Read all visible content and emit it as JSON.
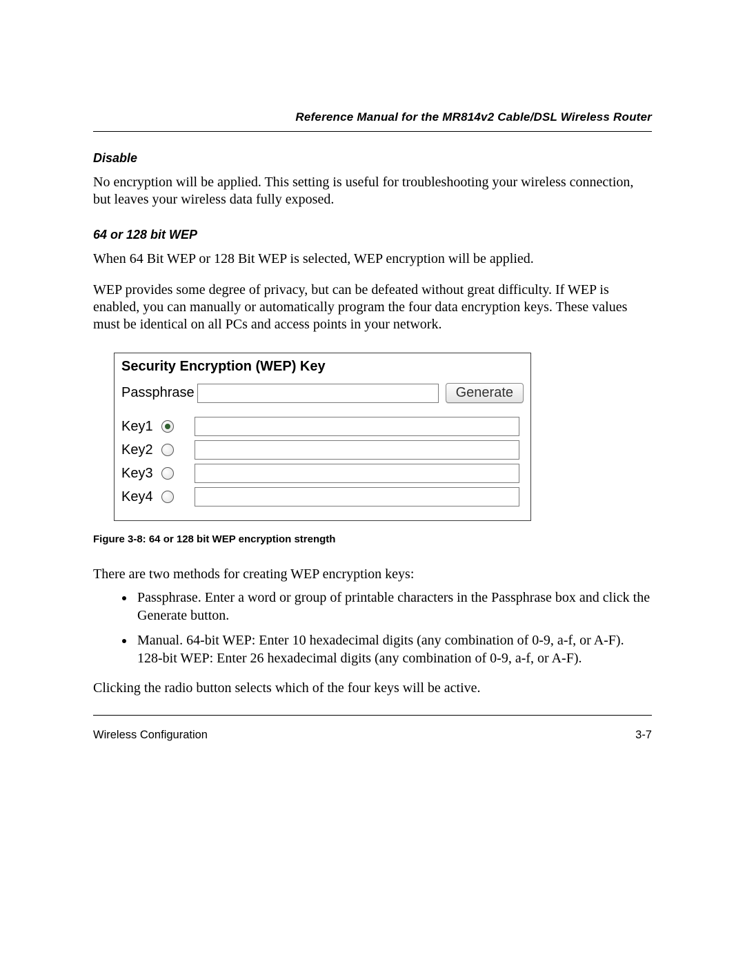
{
  "header": {
    "title": "Reference Manual for the MR814v2 Cable/DSL Wireless Router"
  },
  "sections": {
    "disable": {
      "heading": "Disable",
      "body": "No encryption will be applied. This setting is useful for troubleshooting your wireless connection, but leaves your wireless data fully exposed."
    },
    "wep": {
      "heading": "64 or 128 bit WEP",
      "body1": "When 64 Bit WEP or 128 Bit WEP is selected, WEP encryption will be applied.",
      "body2": "WEP provides some degree of privacy, but can be defeated without great difficulty. If WEP is enabled, you can manually or automatically program the four data encryption keys. These values must be identical on all PCs and access points in your network."
    }
  },
  "figure": {
    "panel_title": "Security Encryption (WEP) Key",
    "passphrase_label": "Passphrase",
    "passphrase_value": "",
    "generate_label": "Generate",
    "keys": [
      {
        "label": "Key1",
        "selected": true,
        "value": ""
      },
      {
        "label": "Key2",
        "selected": false,
        "value": ""
      },
      {
        "label": "Key3",
        "selected": false,
        "value": ""
      },
      {
        "label": "Key4",
        "selected": false,
        "value": ""
      }
    ],
    "caption": "Figure 3-8:  64 or 128 bit WEP encryption strength"
  },
  "post_figure": {
    "intro": "There are two methods for creating WEP encryption keys:",
    "bullets": [
      "Passphrase. Enter a word or group of printable characters in the Passphrase box and click the Generate button.",
      "Manual. 64-bit WEP: Enter 10 hexadecimal digits (any combination of 0-9, a-f, or A-F). 128-bit WEP: Enter 26 hexadecimal digits (any combination of 0-9, a-f, or A-F)."
    ],
    "closing": "Clicking the radio button selects which of the four keys will be active."
  },
  "footer": {
    "left": "Wireless Configuration",
    "right": "3-7"
  }
}
